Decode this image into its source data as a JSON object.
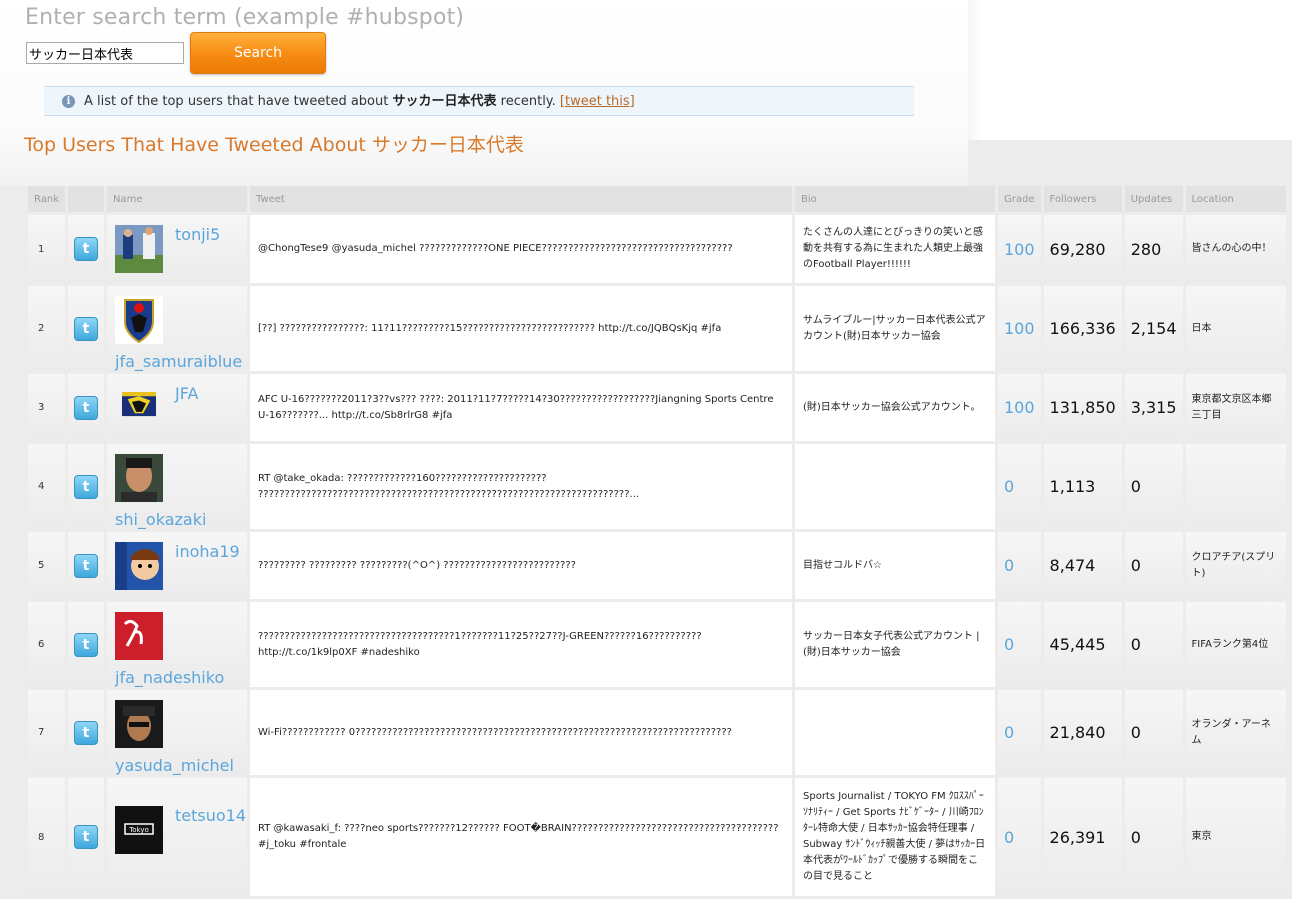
{
  "search": {
    "heading": "Enter search term (example #hubspot)",
    "input_value": "サッカー日本代表",
    "button_label": "Search"
  },
  "info": {
    "icon": "info-icon",
    "prefix": "A list of the top users that have tweeted about",
    "term": "サッカー日本代表",
    "suffix": "recently.",
    "link": "[tweet this]"
  },
  "title": {
    "prefix": "Top Users That Have Tweeted About",
    "term": "サッカー日本代表"
  },
  "columns": {
    "rank": "Rank",
    "icon": "",
    "name": "Name",
    "tweet": "Tweet",
    "bio": "Bio",
    "grade": "Grade",
    "followers": "Followers",
    "updates": "Updates",
    "location": "Location"
  },
  "rows": [
    {
      "rank": "1",
      "name": "tonji5",
      "name_pos": "side",
      "tweet": "@ChongTese9 @yasuda_michel ?????????????ONE PIECE????????????????????????????????????",
      "bio": "たくさんの人達にとびっきりの笑いと感動を共有する為に生まれた人類史上最強のFootball Player!!!!!!",
      "grade": "100",
      "followers": "69,280",
      "updates": "280",
      "location": "皆さんの心の中！"
    },
    {
      "rank": "2",
      "name": "jfa_samuraiblue",
      "name_pos": "below",
      "tweet": "[??] ????????????????: 11?11?????????15????????????????????????? http://t.co/JQBQsKjq #jfa",
      "bio": "サムライブルー|サッカー日本代表公式アカウント(財)日本サッカー協会",
      "grade": "100",
      "followers": "166,336",
      "updates": "2,154",
      "location": "日本"
    },
    {
      "rank": "3",
      "name": "JFA",
      "name_pos": "side",
      "tweet": "AFC U-16???????2011?3??vs??? ????: 2011?11?7?????14?30??????????????????Jiangning Sports Centre U-16???????... http://t.co/Sb8rlrG8 #jfa",
      "bio": "(財)日本サッカー協会公式アカウント。",
      "grade": "100",
      "followers": "131,850",
      "updates": "3,315",
      "location": "東京都文京区本郷三丁目"
    },
    {
      "rank": "4",
      "name": "shi_okazaki",
      "name_pos": "below",
      "tweet": "RT @take_okada: ?????????????160????????????????????? ??????????????????????????????????????????????????????????????????????...",
      "bio": "",
      "grade": "0",
      "followers": "1,113",
      "updates": "0",
      "location": ""
    },
    {
      "rank": "5",
      "name": "inoha19",
      "name_pos": "side",
      "tweet": "????????? ????????? ?????????(^O^) ?????????????????????????",
      "bio": "目指せコルドバ☆",
      "grade": "0",
      "followers": "8,474",
      "updates": "0",
      "location": "クロアチア(スプリト)"
    },
    {
      "rank": "6",
      "name": "jfa_nadeshiko",
      "name_pos": "below",
      "tweet": "?????????????????????????????????????1???????11?25??27??J-GREEN??????16?????????? http://t.co/1k9lp0XF #nadeshiko",
      "bio": "サッカー日本女子代表公式アカウント | (財)日本サッカー協会",
      "grade": "0",
      "followers": "45,445",
      "updates": "0",
      "location": "FIFAランク第4位"
    },
    {
      "rank": "7",
      "name": "yasuda_michel",
      "name_pos": "below",
      "tweet": "Wi-Fi???????????? 0???????????????????????????????????????????????????????????????????????",
      "bio": "",
      "grade": "0",
      "followers": "21,840",
      "updates": "0",
      "location": "オランダ・アーネム"
    },
    {
      "rank": "8",
      "name": "tetsuo14",
      "name_pos": "side",
      "tweet": "RT @kawasaki_f: ????neo sports???????12?????? FOOT�BRAIN??????????????????????????????????????? #j_toku #frontale",
      "bio": "Sports Journalist / TOKYO FM ｸﾛｽｽﾊﾟｰｿﾅﾘﾃｨｰ / Get Sports ﾅﾋﾞｹﾞｰﾀｰ / 川崎ﾌﾛﾝﾀｰﾚ特命大使 / 日本ｻｯｶｰ協会特任理事 / Subway ｻﾝﾄﾞｳｨｯﾁ親善大使 / 夢はｻｯｶｰ日本代表がﾜｰﾙﾄﾞｶｯﾌﾟで優勝する瞬間をこの目で見ること",
      "grade": "0",
      "followers": "26,391",
      "updates": "0",
      "location": "東京"
    }
  ],
  "avatar_label": "Tokyo"
}
